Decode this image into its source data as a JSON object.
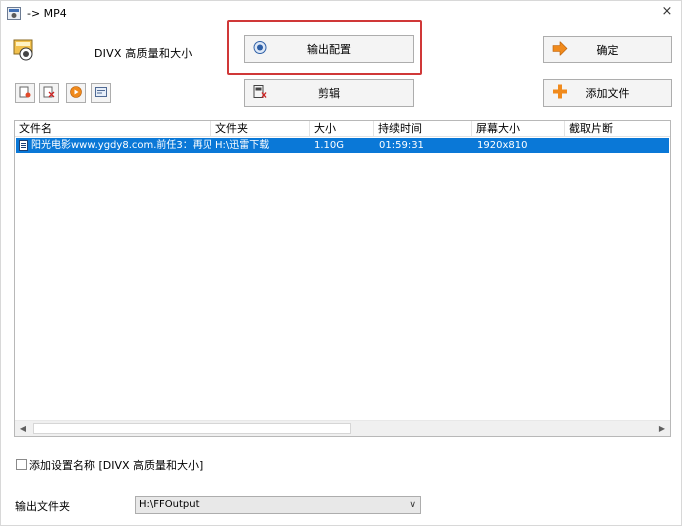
{
  "window": {
    "title": "-> MP4",
    "close_symbol": "×"
  },
  "preset": {
    "label": "DIVX 高质量和大小"
  },
  "buttons": {
    "output_config": "输出配置",
    "ok": "确定",
    "clip": "剪辑",
    "add_file": "添加文件"
  },
  "table": {
    "columns": [
      "文件名",
      "文件夹",
      "大小",
      "持续时间",
      "屏幕大小",
      "截取片断"
    ],
    "rows": [
      {
        "filename": "阳光电影www.ygdy8.com.前任3：再见...",
        "folder": "H:\\迅雷下载",
        "size": "1.10G",
        "duration": "01:59:31",
        "resolution": "1920x810",
        "clip": ""
      }
    ]
  },
  "bottom": {
    "checkbox_label": "添加设置名称 [DIVX 高质量和大小]",
    "output_folder_label": "输出文件夹",
    "output_folder_value": "H:\\FFOutput"
  },
  "colors": {
    "selection": "#0a78d7",
    "highlight": "#d03838",
    "accent_orange": "#f08a1c"
  },
  "icons": [
    "app-icon",
    "close-icon",
    "preset-video-icon",
    "output-config-icon",
    "ok-arrow-icon",
    "clip-icon",
    "add-plus-icon",
    "add-item-icon",
    "remove-item-icon",
    "play-icon",
    "info-icon",
    "file-icon"
  ]
}
